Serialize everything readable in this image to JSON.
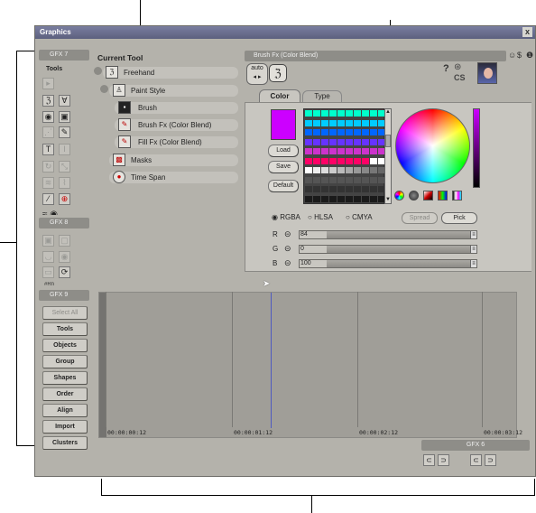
{
  "window": {
    "title": "Graphics",
    "close_label": "x"
  },
  "sidebar": {
    "gfx7_label": "GFX 7",
    "tools_label": "Tools",
    "gfx8_label": "GFX 8",
    "gfx9_label": "GFX 9",
    "buttons": [
      {
        "label": "Select All",
        "enabled": false
      },
      {
        "label": "Tools",
        "enabled": true
      },
      {
        "label": "Objects",
        "enabled": true
      },
      {
        "label": "Group",
        "enabled": true
      },
      {
        "label": "Shapes",
        "enabled": true
      },
      {
        "label": "Order",
        "enabled": true
      },
      {
        "label": "Align",
        "enabled": true
      },
      {
        "label": "Import",
        "enabled": true
      },
      {
        "label": "Clusters",
        "enabled": true
      }
    ],
    "partial_label": "#Rn"
  },
  "tree": {
    "heading": "Current Tool",
    "items": [
      {
        "label": "Freehand"
      },
      {
        "label": "Paint Style"
      },
      {
        "label": "Brush"
      },
      {
        "label": "Brush Fx (Color Blend)"
      },
      {
        "label": "Fill Fx (Color Blend)"
      },
      {
        "label": "Masks"
      },
      {
        "label": "Time Span"
      }
    ]
  },
  "panel": {
    "title": "Brush Fx (Color Blend)",
    "auto_label": "auto",
    "cs_label": "CS",
    "tabs": [
      {
        "label": "Color",
        "active": true
      },
      {
        "label": "Type",
        "active": false
      }
    ],
    "current_color": "#cc00ff",
    "buttons": {
      "load": "Load",
      "save": "Save",
      "default": "Default",
      "spread": "Spread",
      "pick": "Pick"
    },
    "modes": [
      {
        "label": "RGBA",
        "selected": true
      },
      {
        "label": "HLSA",
        "selected": false
      },
      {
        "label": "CMYA",
        "selected": false
      }
    ],
    "channels": [
      {
        "name": "R",
        "value": "84"
      },
      {
        "name": "G",
        "value": "0"
      },
      {
        "name": "B",
        "value": "100"
      }
    ],
    "palette_rows": [
      [
        "#00ffcc",
        "#00ffcc",
        "#00ffcc",
        "#00ffcc",
        "#00ffcc",
        "#00ffcc",
        "#00ffcc",
        "#00ffcc",
        "#00ffcc",
        "#00ffcc"
      ],
      [
        "#00ccff",
        "#00ccff",
        "#00ccff",
        "#00ccff",
        "#00ccff",
        "#00ccff",
        "#00ccff",
        "#00ccff",
        "#00ccff",
        "#00ccff"
      ],
      [
        "#0066ff",
        "#0066ff",
        "#0066ff",
        "#0066ff",
        "#0066ff",
        "#0066ff",
        "#0066ff",
        "#0066ff",
        "#0066ff",
        "#0066ff"
      ],
      [
        "#6633ff",
        "#6633ff",
        "#6633ff",
        "#6633ff",
        "#6633ff",
        "#6633ff",
        "#6633ff",
        "#6633ff",
        "#6633ff",
        "#6633ff"
      ],
      [
        "#cc33cc",
        "#cc33cc",
        "#cc33cc",
        "#cc33cc",
        "#cc33cc",
        "#cc33cc",
        "#cc33cc",
        "#cc33cc",
        "#cc33cc",
        "#cc33cc"
      ],
      [
        "#ff0066",
        "#ff0066",
        "#ff0066",
        "#ff0066",
        "#ff0066",
        "#ff0066",
        "#ff0066",
        "#ff0066",
        "#ffffff",
        "#ffffff"
      ],
      [
        "#ffffff",
        "#eeeeee",
        "#dddddd",
        "#cccccc",
        "#bbbbbb",
        "#aaaaaa",
        "#999999",
        "#888888",
        "#777777",
        "#666666"
      ],
      [
        "#555555",
        "#555555",
        "#555555",
        "#555555",
        "#555555",
        "#555555",
        "#555555",
        "#555555",
        "#555555",
        "#555555"
      ],
      [
        "#333333",
        "#333333",
        "#333333",
        "#333333",
        "#333333",
        "#333333",
        "#333333",
        "#333333",
        "#333333",
        "#333333"
      ],
      [
        "#1a1a1a",
        "#1a1a1a",
        "#1a1a1a",
        "#1a1a1a",
        "#1a1a1a",
        "#1a1a1a",
        "#1a1a1a",
        "#1a1a1a",
        "#1a1a1a",
        "#1a1a1a"
      ]
    ]
  },
  "timeline": {
    "timecodes": [
      "00:00:00:12",
      "00:00:01:12",
      "00:00:02:12",
      "00:00:03:12"
    ]
  },
  "gfx6": {
    "label": "GFX 6"
  }
}
